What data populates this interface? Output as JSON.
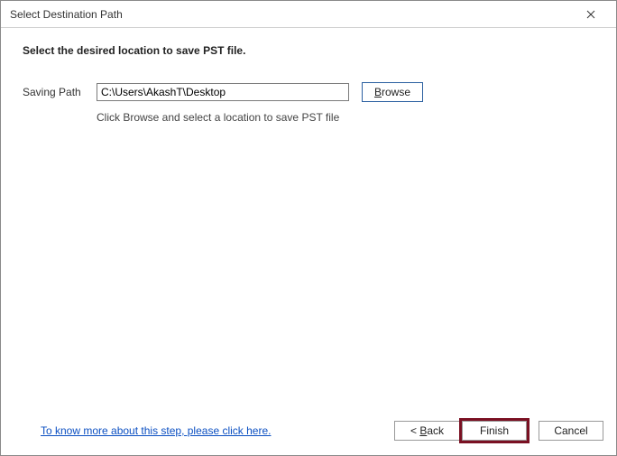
{
  "window": {
    "title": "Select Destination Path"
  },
  "instruction": "Select the desired location to save PST file.",
  "form": {
    "label": "Saving Path",
    "path_value": "C:\\Users\\AkashT\\Desktop",
    "browse_prefix": "B",
    "browse_rest": "rowse",
    "hint": "Click Browse and select a location to save PST file"
  },
  "footer": {
    "help_link": "To know more about this step, please click here.",
    "back_prefix": "< ",
    "back_u": "B",
    "back_rest": "ack",
    "finish": "Finish",
    "cancel": "Cancel"
  }
}
